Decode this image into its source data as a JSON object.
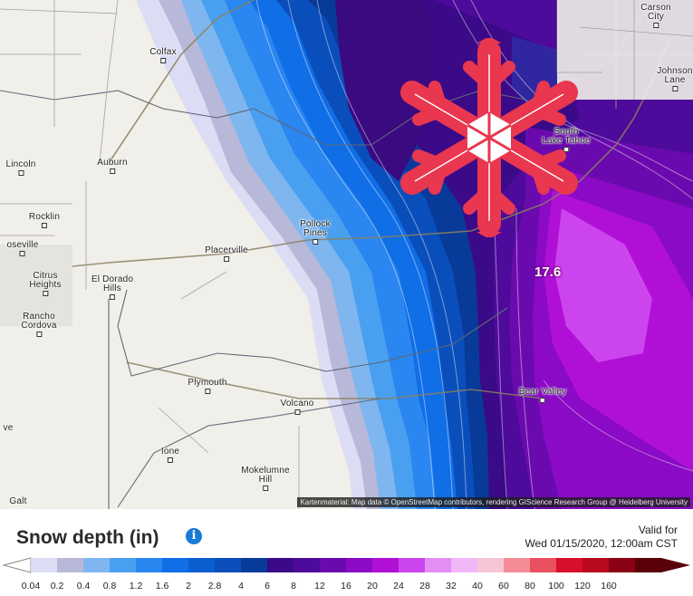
{
  "map": {
    "places": [
      {
        "name": "Colfax"
      },
      {
        "name": "Carson\nCity"
      },
      {
        "name": "Johnson\nLane"
      },
      {
        "name": "Lincoln"
      },
      {
        "name": "Auburn"
      },
      {
        "name": "South\nLake Tahoe"
      },
      {
        "name": "Rocklin"
      },
      {
        "name": "Pollock\nPines"
      },
      {
        "name": "oseville"
      },
      {
        "name": "Placerville"
      },
      {
        "name": "Citrus\nHeights"
      },
      {
        "name": "El Dorado\nHills"
      },
      {
        "name": "Rancho\nCordova"
      },
      {
        "name": "Plymouth"
      },
      {
        "name": "Bear Valley"
      },
      {
        "name": "Volcano"
      },
      {
        "name": "Ione"
      },
      {
        "name": "Mokelumne\nHill"
      },
      {
        "name": "ve"
      },
      {
        "name": "Galt"
      }
    ],
    "max_value_label": "17.6",
    "attribution": "Kartenmaterial: Map data © OpenStreetMap contributors, rendering GIScience Research Group @ Heidelberg University",
    "overlay_icon": "snowflake-icon",
    "colors": {
      "snowflake": "#e8374e",
      "max_region": "#d040f0"
    }
  },
  "legend": {
    "title": "Snow depth (in)",
    "info_icon": "info-icon",
    "valid_label": "Valid for",
    "valid_time": "Wed 01/15/2020, 12:00am CST",
    "ticks": [
      "0.04",
      "0.2",
      "0.4",
      "0.8",
      "1.2",
      "1.6",
      "2",
      "2.8",
      "4",
      "6",
      "8",
      "12",
      "16",
      "20",
      "24",
      "28",
      "32",
      "40",
      "60",
      "80",
      "100",
      "120",
      "160"
    ],
    "colors": [
      "#dcdcf4",
      "#b8b8d8",
      "#7fb6f0",
      "#4aa0f0",
      "#2a86f0",
      "#106ee6",
      "#0a5ed0",
      "#0a4ebc",
      "#083a9a",
      "#3a0a88",
      "#4e0a9a",
      "#6a0aae",
      "#8a0ac6",
      "#b010d6",
      "#cc44ee",
      "#e28ef4",
      "#f0b8f8",
      "#f6c6d6",
      "#f48c98",
      "#ea5060",
      "#d6102a",
      "#b80a1c",
      "#8a0014",
      "#5a0008"
    ]
  }
}
